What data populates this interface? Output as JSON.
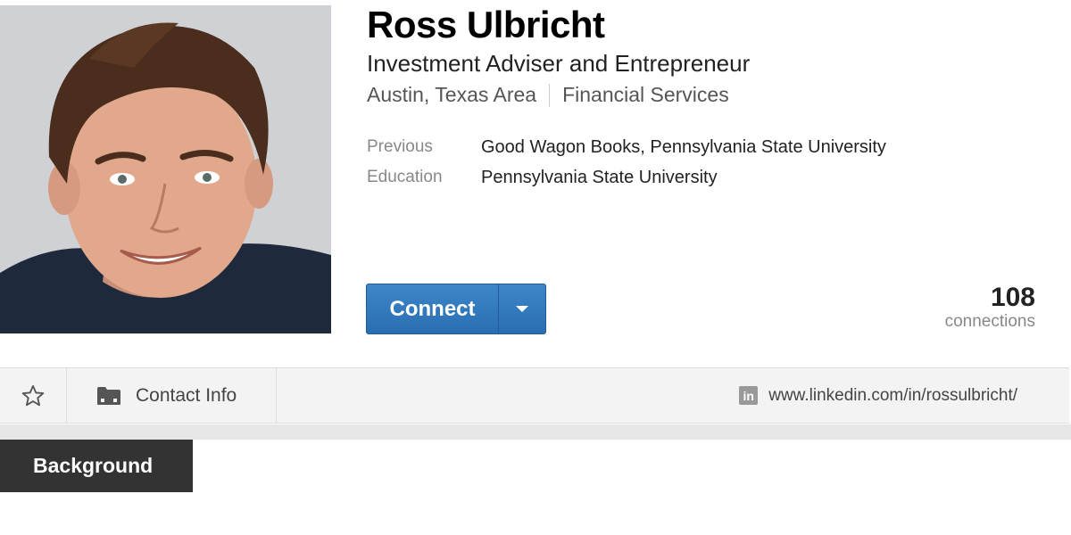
{
  "profile": {
    "name": "Ross Ulbricht",
    "headline": "Investment Adviser and Entrepreneur",
    "location": "Austin, Texas Area",
    "industry": "Financial Services",
    "previous_label": "Previous",
    "previous_value": "Good Wagon Books, Pennsylvania State University",
    "education_label": "Education",
    "education_value": "Pennsylvania State University"
  },
  "actions": {
    "connect_label": "Connect",
    "connections_count": "108",
    "connections_label": "connections"
  },
  "toolbar": {
    "contact_info_label": "Contact Info",
    "profile_url": "www.linkedin.com/in/rossulbricht/",
    "linkedin_icon_text": "in"
  },
  "sections": {
    "background_label": "Background"
  },
  "icons": [
    "star-icon",
    "folder-icon",
    "linkedin-icon",
    "chevron-down-icon"
  ],
  "colors": {
    "connect_button": "#2a6eb2",
    "background_tab": "#333333"
  }
}
